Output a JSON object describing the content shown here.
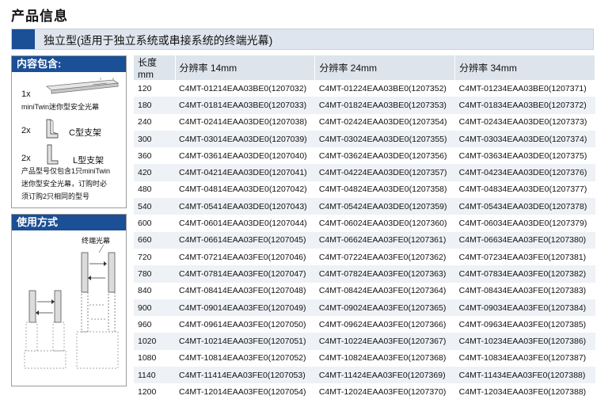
{
  "page_title": "产品信息",
  "section_title": "独立型(适用于独立系统或串接系统的终端光幕)",
  "contents_panel": {
    "heading": "内容包含:",
    "item1_qty": "1x",
    "item1_label": "miniTwin迷你型安全光幕",
    "item2_qty": "2x",
    "item2_label": "C型支架",
    "item3_qty": "2x",
    "item3_label": "L型支架",
    "note_line1": "产品型号仅包含1只miniTwin",
    "note_line2": "迷你型安全光幕，订购时必",
    "note_line3": "须订购2只相同的型号"
  },
  "usage_panel": {
    "heading": "使用方式",
    "label": "终端光幕"
  },
  "table": {
    "headers": [
      "长度mm",
      "分辨率 14mm",
      "分辨率 24mm",
      "分辨率 34mm"
    ],
    "rows": [
      [
        "120",
        "C4MT-01214EAA03BE0(1207032)",
        "C4MT-01224EAA03BE0(1207352)",
        "C4MT-01234EAA03BE0(1207371)"
      ],
      [
        "180",
        "C4MT-01814EAA03BE0(1207033)",
        "C4MT-01824EAA03BE0(1207353)",
        "C4MT-01834EAA03BE0(1207372)"
      ],
      [
        "240",
        "C4MT-02414EAA03DE0(1207038)",
        "C4MT-02424EAA03DE0(1207354)",
        "C4MT-02434EAA03DE0(1207373)"
      ],
      [
        "300",
        "C4MT-03014EAA03DE0(1207039)",
        "C4MT-03024EAA03DE0(1207355)",
        "C4MT-03034EAA03DE0(1207374)"
      ],
      [
        "360",
        "C4MT-03614EAA03DE0(1207040)",
        "C4MT-03624EAA03DE0(1207356)",
        "C4MT-03634EAA03DE0(1207375)"
      ],
      [
        "420",
        "C4MT-04214EAA03DE0(1207041)",
        "C4MT-04224EAA03DE0(1207357)",
        "C4MT-04234EAA03DE0(1207376)"
      ],
      [
        "480",
        "C4MT-04814EAA03DE0(1207042)",
        "C4MT-04824EAA03DE0(1207358)",
        "C4MT-04834EAA03DE0(1207377)"
      ],
      [
        "540",
        "C4MT-05414EAA03DE0(1207043)",
        "C4MT-05424EAA03DE0(1207359)",
        "C4MT-05434EAA03DE0(1207378)"
      ],
      [
        "600",
        "C4MT-06014EAA03DE0(1207044)",
        "C4MT-06024EAA03DE0(1207360)",
        "C4MT-06034EAA03DE0(1207379)"
      ],
      [
        "660",
        "C4MT-06614EAA03FE0(1207045)",
        "C4MT-06624EAA03FE0(1207361)",
        "C4MT-06634EAA03FE0(1207380)"
      ],
      [
        "720",
        "C4MT-07214EAA03FE0(1207046)",
        "C4MT-07224EAA03FE0(1207362)",
        "C4MT-07234EAA03FE0(1207381)"
      ],
      [
        "780",
        "C4MT-07814EAA03FE0(1207047)",
        "C4MT-07824EAA03FE0(1207363)",
        "C4MT-07834EAA03FE0(1207382)"
      ],
      [
        "840",
        "C4MT-08414EAA03FE0(1207048)",
        "C4MT-08424EAA03FE0(1207364)",
        "C4MT-08434EAA03FE0(1207383)"
      ],
      [
        "900",
        "C4MT-09014EAA03FE0(1207049)",
        "C4MT-09024EAA03FE0(1207365)",
        "C4MT-09034EAA03FE0(1207384)"
      ],
      [
        "960",
        "C4MT-09614EAA03FE0(1207050)",
        "C4MT-09624EAA03FE0(1207366)",
        "C4MT-09634EAA03FE0(1207385)"
      ],
      [
        "1020",
        "C4MT-10214EAA03FE0(1207051)",
        "C4MT-10224EAA03FE0(1207367)",
        "C4MT-10234EAA03FE0(1207386)"
      ],
      [
        "1080",
        "C4MT-10814EAA03FE0(1207052)",
        "C4MT-10824EAA03FE0(1207368)",
        "C4MT-10834EAA03FE0(1207387)"
      ],
      [
        "1140",
        "C4MT-11414EAA03FE0(1207053)",
        "C4MT-11424EAA03FE0(1207369)",
        "C4MT-11434EAA03FE0(1207388)"
      ],
      [
        "1200",
        "C4MT-12014EAA03FE0(1207054)",
        "C4MT-12024EAA03FE0(1207370)",
        "C4MT-12034EAA03FE0(1207388)"
      ]
    ]
  }
}
